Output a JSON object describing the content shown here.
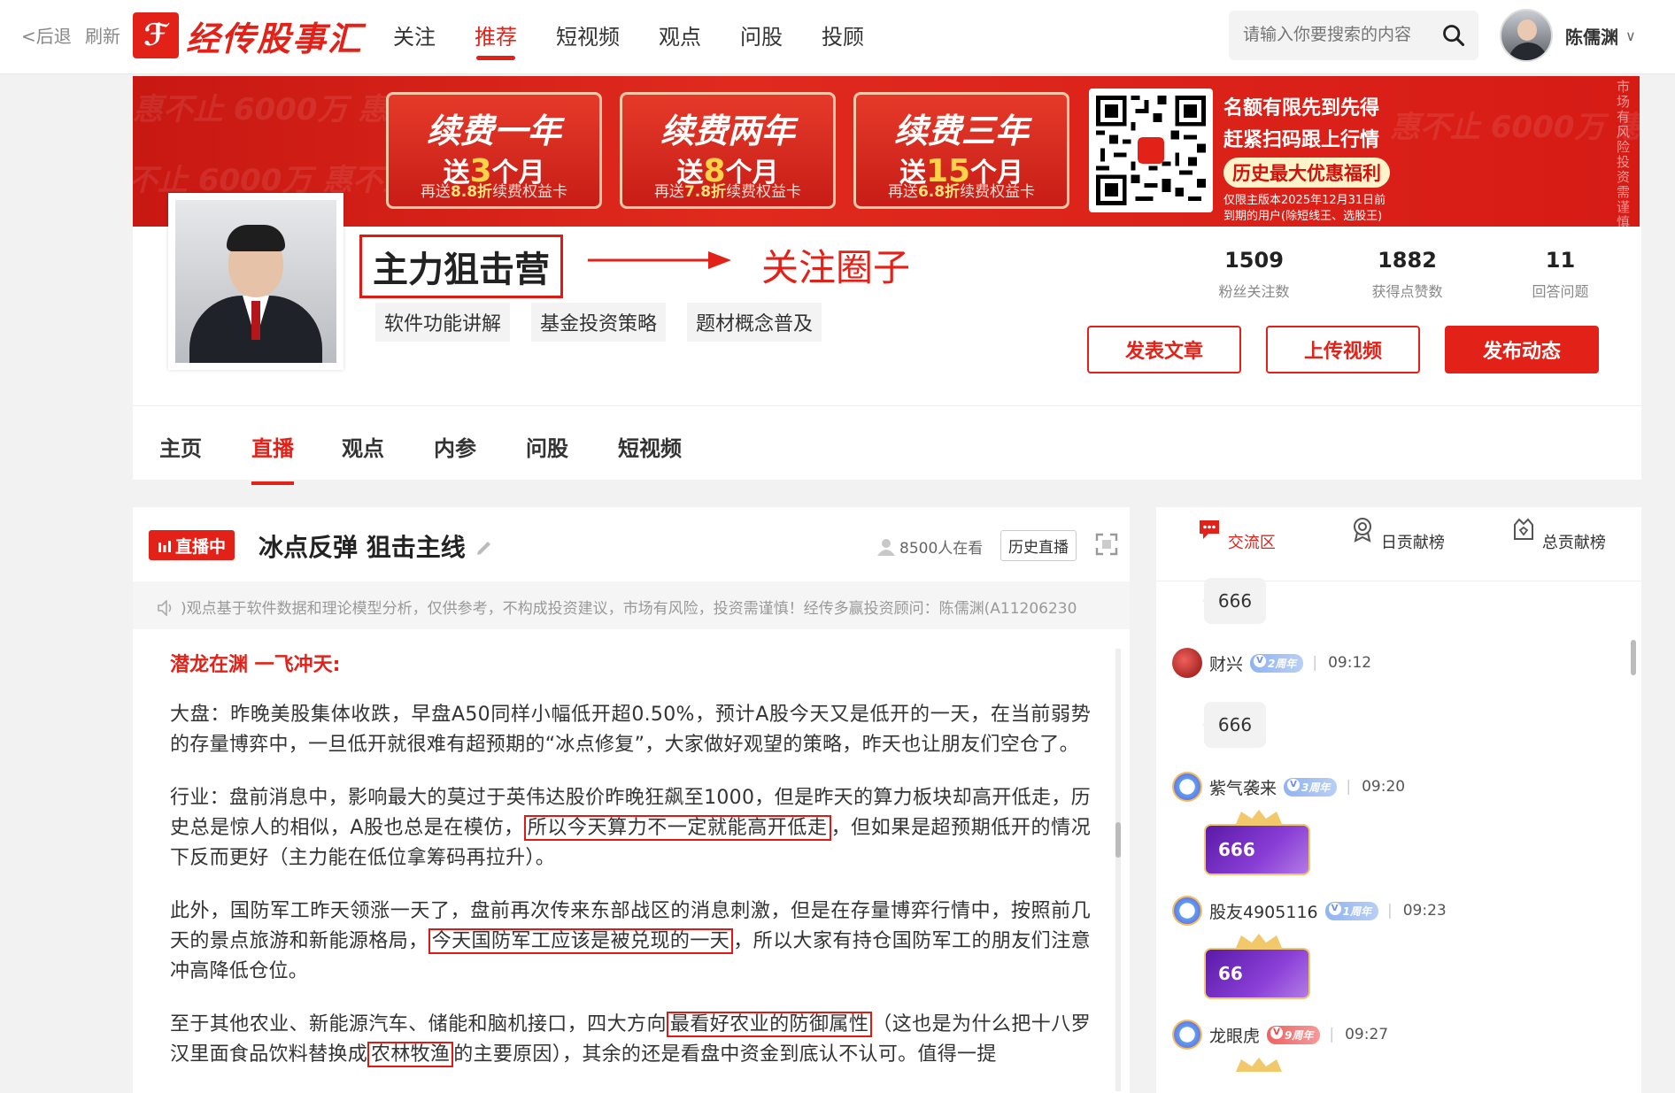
{
  "topbar": {
    "back_label": "<后退",
    "refresh_label": "刷新",
    "logo_text": "经传股事汇",
    "nav": [
      "关注",
      "推荐",
      "短视频",
      "观点",
      "问股",
      "投顾"
    ],
    "active_nav": "推荐",
    "search_placeholder": "请输入你要搜索的内容",
    "user_name": "陈儒渊",
    "caret": "∨"
  },
  "banner": {
    "cards": [
      {
        "title": "续费一年",
        "gift_pre": "送",
        "gift_num": "3",
        "gift_post": "个月",
        "extra_pre": "再送",
        "extra_rate": "8.8折",
        "extra_post": "续费权益卡"
      },
      {
        "title": "续费两年",
        "gift_pre": "送",
        "gift_num": "8",
        "gift_post": "个月",
        "extra_pre": "再送",
        "extra_rate": "7.8折",
        "extra_post": "续费权益卡"
      },
      {
        "title": "续费三年",
        "gift_pre": "送",
        "gift_num": "15",
        "gift_post": "个月",
        "extra_pre": "再送",
        "extra_rate": "6.8折",
        "extra_post": "续费权益卡"
      }
    ],
    "line1": "名额有限先到先得",
    "line2": "赶紧扫码跟上行情",
    "pill": "历史最大优惠福利",
    "note1": "仅限主版本2025年12月31日前",
    "note2": "到期的用户(除短线王、选股王)",
    "side_text": "市场有风险投资需谨慎",
    "bg_text": "惠不止 6000万 惠不止 优惠不止"
  },
  "profile": {
    "name": "主力狙击营",
    "annotation": "关注圈子",
    "tags": [
      "软件功能讲解",
      "基金投资策略",
      "题材概念普及"
    ],
    "stats": [
      {
        "num": "1509",
        "label": "粉丝关注数"
      },
      {
        "num": "1882",
        "label": "获得点赞数"
      },
      {
        "num": "11",
        "label": "回答问题"
      }
    ],
    "actions": [
      "发表文章",
      "上传视频",
      "发布动态"
    ]
  },
  "tabs": [
    "主页",
    "直播",
    "观点",
    "内参",
    "问股",
    "短视频"
  ],
  "active_tab": "直播",
  "live": {
    "badge": "直播中",
    "title": "冰点反弹 狙击主线",
    "viewers": "8500人在看",
    "history_label": "历史直播",
    "notice": ")观点基于软件数据和理论模型分析，仅供参考，不构成投资建议，市场有风险，投资需谨慎！经传多赢投资顾问：陈儒渊(A11206230",
    "subheading": "潜龙在渊 一飞冲天:",
    "p1": "大盘：昨晚美股集体收跌，早盘A50同样小幅低开超0.50%，预计A股今天又是低开的一天，在当前弱势的存量博弈中，一旦低开就很难有超预期的“冰点修复”，大家做好观望的策略，昨天也让朋友们空仓了。",
    "p2a": "行业：盘前消息中，影响最大的莫过于英伟达股价昨晚狂飙至1000，但是昨天的算力板块却高开低走，历史总是惊人的相似，A股也总是在模仿，",
    "p2hl": "所以今天算力不一定就能高开低走",
    "p2b": "，但如果是超预期低开的情况下反而更好（主力能在低位拿筹码再拉升）。",
    "p3a": "此外，国防军工昨天领涨一天了，盘前再次传来东部战区的消息刺激，但是在存量博弈行情中，按照前几天的景点旅游和新能源格局，",
    "p3hl": "今天国防军工应该是被兑现的一天",
    "p3b": "，所以大家有持仓国防军工的朋友们注意冲高降低仓位。",
    "p4a": "至于其他农业、新能源汽车、储能和脑机接口，四大方向",
    "p4hl1": "最看好农业的防御属性",
    "p4b": "（这也是为什么把十八罗汉里面食品饮料替换成",
    "p4hl2": "农林牧渔",
    "p4c": "的主要原因），其余的还是看盘中资金到底认不认可。值得一提"
  },
  "chat": {
    "tabs": [
      "交流区",
      "日贡献榜",
      "总贡献榜"
    ],
    "active_tab": "交流区",
    "messages": [
      {
        "text": "666"
      },
      {
        "name": "财兴",
        "badge": "2周年",
        "time": "09:12",
        "text": "666"
      },
      {
        "name": "紫气袭来",
        "badge": "3周年",
        "time": "09:20",
        "text": "666"
      },
      {
        "name": "股友4905116",
        "badge": "1周年",
        "time": "09:23",
        "text": "66"
      },
      {
        "name": "龙眼虎",
        "badge": "9周年",
        "time": "09:27"
      }
    ]
  },
  "colors": {
    "accent": "#e22219",
    "gift": "#ffd24a",
    "vip_purple": "#6a28b8"
  }
}
